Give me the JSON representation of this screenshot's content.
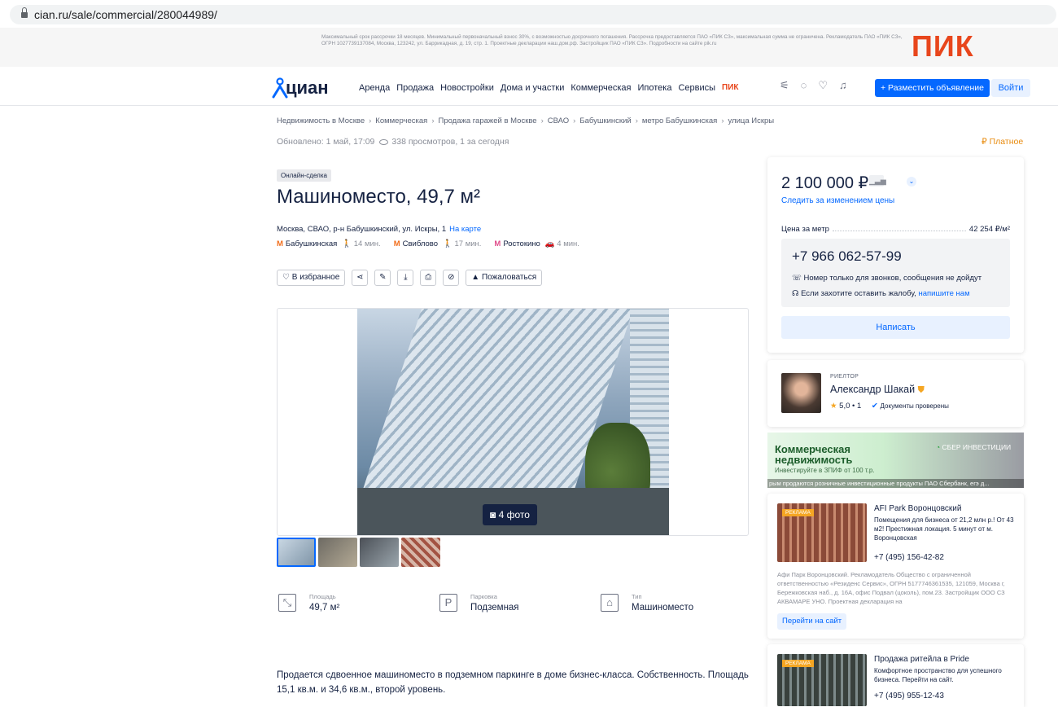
{
  "browser": {
    "url": "cian.ru/sale/commercial/280044989/"
  },
  "promo": {
    "text": "Максимальный срок рассрочки 18 месяцев. Минимальный первоначальный взнос 30%, с возможностью досрочного погашения. Рассрочка предоставляется ПАО «ПИК СЗ», максимальная сумма не ограничена. Рекламодатель ПАО «ПИК СЗ», ОГРН 1027739137084, Москва, 123242, ул. Баррикадная, д. 19, стр. 1. Проектные декларации наш.дом.рф. Застройщик ПАО «ПИК СЗ». Подробности на сайте pik.ru",
    "brand": "ПИК"
  },
  "header": {
    "logo": "циан",
    "nav": [
      "Аренда",
      "Продажа",
      "Новостройки",
      "Дома и участки",
      "Коммерческая",
      "Ипотека",
      "Сервисы"
    ],
    "nav_pik": "ПИК",
    "post_button": "+ Разместить объявление",
    "login_button": "Войти"
  },
  "breadcrumbs": [
    "Недвижимость в Москве",
    "Коммерческая",
    "Продажа гаражей в Москве",
    "СВАО",
    "Бабушкинский",
    "метро Бабушкинская",
    "улица Искры"
  ],
  "meta": {
    "updated": "Обновлено: 1 май, 17:09",
    "views": "338 просмотров, 1 за сегодня",
    "paid": "Платное"
  },
  "listing": {
    "badge": "Онлайн-сделка",
    "title": "Машиноместо, 49,7 м²",
    "address": "Москва, СВАО, р-н Бабушкинский, ул. Искры, 1",
    "map_link": "На карте",
    "metro": [
      {
        "name": "Бабушкинская",
        "mode": "walk",
        "time": "14 мин."
      },
      {
        "name": "Свиблово",
        "mode": "walk",
        "time": "17 мин."
      },
      {
        "name": "Ростокино",
        "mode": "car",
        "time": "4 мин."
      }
    ],
    "actions": {
      "favorite": "В избранное",
      "complain": "Пожаловаться"
    },
    "photo_count": "4 фото",
    "specs": [
      {
        "label": "Площадь",
        "value": "49,7 м²",
        "icon": "area-icon"
      },
      {
        "label": "Парковка",
        "value": "Подземная",
        "icon": "parking-icon"
      },
      {
        "label": "Тип",
        "value": "Машиноместо",
        "icon": "garage-icon"
      }
    ],
    "description": "Продается сдвоенное машиноместо в подземном паркинге в доме бизнес-класса. Собственность. Площадь 15,1 кв.м. и 34,6 кв.м., второй уровень."
  },
  "price_card": {
    "price": "2 100 000 ₽",
    "follow": "Следить за изменением цены",
    "per_meter_label": "Цена за метр",
    "per_meter_value": "42 254 ₽/м²",
    "phone": "+7 966 062-57-99",
    "note1": "Номер только для звонков, сообщения не дойдут",
    "note2": "Если захотите оставить жалобу,",
    "note2_link": "напишите нам",
    "write_button": "Написать"
  },
  "realtor": {
    "role": "РИЕЛТОР",
    "name": "Александр Шакай",
    "rating": "5,0 • 1",
    "docs": "Документы проверены"
  },
  "sber_banner": {
    "title1": "Коммерческая",
    "title2": "недвижимость",
    "subtitle": "Инвестируйте в ЗПИФ от 100 т.р.",
    "logo": "СБЕР ИНВЕСТИЦИИ",
    "stripe": "рым продаются розничные инвестиционные продукты ПАО Сбербанк, егэ д..."
  },
  "ads": [
    {
      "badge": "РЕКЛАМА",
      "title": "AFI Park Воронцовский",
      "text": "Помещения для бизнеса от 21,2 млн р.! От 43 м2! Престижная локация. 5 минут от м. Воронцовская",
      "phone": "+7 (495) 156-42-82",
      "legal": "Афи Парк Воронцовский. Рекламодатель Общество с ограниченной ответственностью «Резиденс Сервис», ОГРН 5177746361535, 121059, Москва г, Бережковская наб., д. 16А, офис Подвал (цоколь), пом.23. Застройщик ООО СЗ АКВАМАРЕ УНО. Проектная декларация на",
      "link": "Перейти на сайт"
    },
    {
      "badge": "РЕКЛАМА",
      "title": "Продажа ритейла в Pride",
      "text": "Комфортное пространство для успешного бизнеса. Перейти на сайт.",
      "phone": "+7 (495) 955-12-43"
    }
  ]
}
